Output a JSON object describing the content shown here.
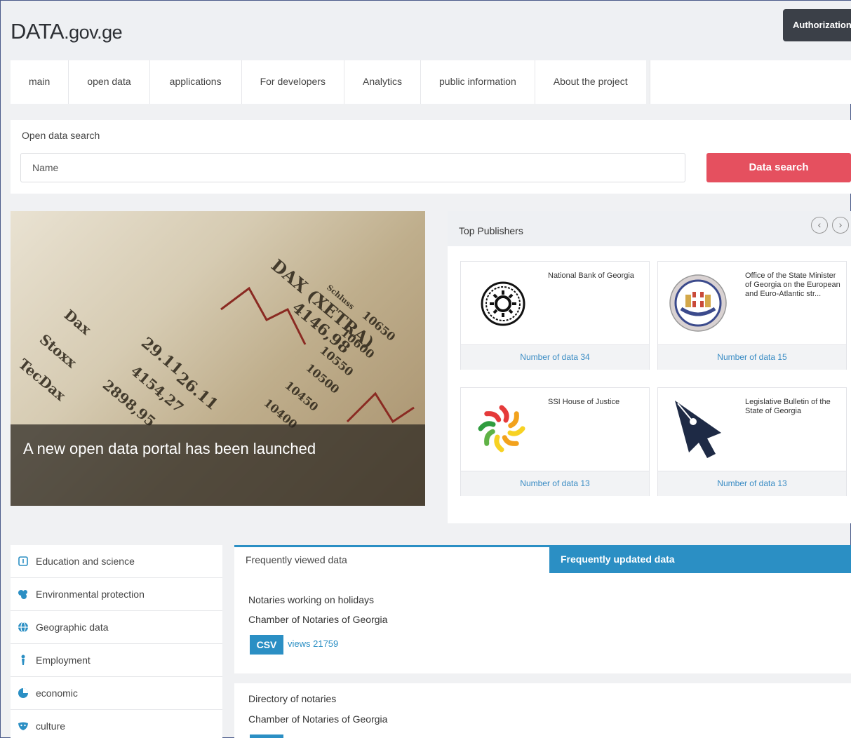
{
  "header": {
    "logo_main": "DATA",
    "logo_suffix": ".gov.ge",
    "auth_label": "Authorization"
  },
  "nav": {
    "items": [
      {
        "label": "main"
      },
      {
        "label": "open data"
      },
      {
        "label": "applications"
      },
      {
        "label": "For developers"
      },
      {
        "label": "Analytics"
      },
      {
        "label": "public information"
      },
      {
        "label": "About the project"
      }
    ]
  },
  "search": {
    "title": "Open data search",
    "placeholder": "Name",
    "button_label": "Data search"
  },
  "hero": {
    "caption": "A new open data portal has been launched",
    "image_text": [
      "DAX (XETRA)",
      "4146,98",
      "10650",
      "10600",
      "10550",
      "10500",
      "10450",
      "10400",
      "Dax",
      "Stoxx",
      "TecDax",
      "29.11",
      "26.11",
      "4154,27",
      "2898,95",
      "Schluss"
    ]
  },
  "publishers": {
    "title": "Top Publishers",
    "prev_icon": "chevron-left-icon",
    "next_icon": "chevron-right-icon",
    "cards": [
      {
        "name": "National Bank of Georgia",
        "count": "Number of data 34",
        "logo": "national-bank-logo"
      },
      {
        "name": "Office of the State Minister of Georgia on the European and Euro-Atlantic str...",
        "count": "Number of data 15",
        "logo": "state-minister-seal-logo"
      },
      {
        "name": "SSI House of Justice",
        "count": "Number of data 13",
        "logo": "house-of-justice-logo"
      },
      {
        "name": "Legislative Bulletin of the State of Georgia",
        "count": "Number of data 13",
        "logo": "pen-nib-logo"
      }
    ]
  },
  "categories": [
    {
      "label": "Education and science",
      "icon": "book-icon"
    },
    {
      "label": "Environmental protection",
      "icon": "leaf-icon"
    },
    {
      "label": "Geographic data",
      "icon": "globe-icon"
    },
    {
      "label": "Employment",
      "icon": "person-tie-icon"
    },
    {
      "label": "economic",
      "icon": "pie-chart-icon"
    },
    {
      "label": "culture",
      "icon": "masks-icon"
    }
  ],
  "tabs": {
    "active": "Frequently viewed data",
    "other": "Frequently updated data"
  },
  "feed": [
    {
      "title": "Notaries working on holidays",
      "publisher": "Chamber of Notaries of Georgia",
      "format": "CSV",
      "views": "views 21759"
    },
    {
      "title": "Directory of notaries",
      "publisher": "Chamber of Notaries of Georgia"
    }
  ],
  "colors": {
    "accent_blue": "#2b8fc4",
    "search_red": "#e5505f",
    "auth_dark": "#3b4048"
  }
}
